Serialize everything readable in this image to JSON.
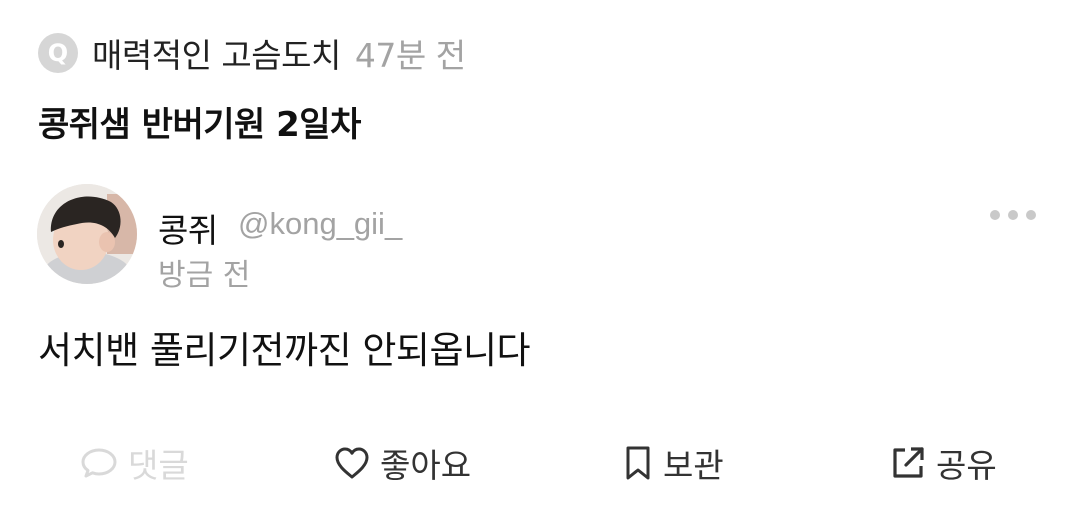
{
  "meta": {
    "badge": "Q",
    "community": "매력적인 고슴도치",
    "time_ago": "47분 전"
  },
  "post": {
    "title": "콩쥐샘 반버기원 2일차",
    "body": "서치밴 풀리기전까진 안되옵니다"
  },
  "author": {
    "name": "콩쥐",
    "handle": "@kong_gii_",
    "posted_time": "방금 전"
  },
  "actions": {
    "comment": "댓글",
    "like": "좋아요",
    "save": "보관",
    "share": "공유"
  },
  "colors": {
    "muted_text": "#a3a3a3",
    "disabled_text": "#d9d9d9",
    "primary_text": "#111111",
    "badge_bg": "#d6d6d6"
  },
  "icons": {
    "more": "more-dots-icon",
    "comment": "speech-bubble-icon",
    "like": "heart-icon",
    "save": "bookmark-icon",
    "share": "share-external-icon"
  }
}
